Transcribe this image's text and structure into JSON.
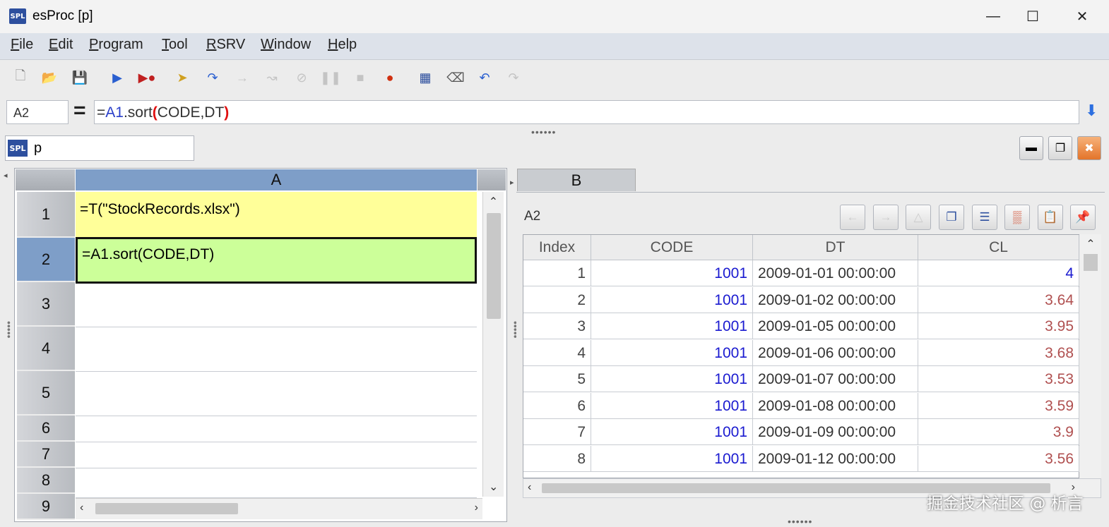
{
  "window": {
    "app_logo": "SPL",
    "title": "esProc  [p]"
  },
  "menu": [
    {
      "accel": "F",
      "rest": "ile"
    },
    {
      "accel": "E",
      "rest": "dit"
    },
    {
      "accel": "P",
      "rest": "rogram"
    },
    {
      "accel": "T",
      "rest": "ool"
    },
    {
      "accel": "R",
      "rest": "SRV"
    },
    {
      "accel": "W",
      "rest": "indow"
    },
    {
      "accel": "H",
      "rest": "elp"
    }
  ],
  "formula_bar": {
    "cell_ref": "A2",
    "eq": "=",
    "formula": {
      "p1": "=",
      "ref": "A1",
      "p2": ".sort",
      "open": "(",
      "args": "CODE,DT",
      "close": ")"
    }
  },
  "doc_tab": {
    "logo": "SPL",
    "name": "p"
  },
  "grid": {
    "column_header": "A",
    "rows": [
      "1",
      "2",
      "3",
      "4",
      "5",
      "6",
      "7",
      "8",
      "9"
    ],
    "cells": {
      "A1": "=T(\"StockRecords.xlsx\")",
      "A2": "=A1.sort(CODE,DT)"
    }
  },
  "result": {
    "tab": "B",
    "cell": "A2",
    "columns": [
      "Index",
      "CODE",
      "DT",
      "CL"
    ],
    "rows": [
      [
        "1",
        "1001",
        "2009-01-01 00:00:00",
        "4"
      ],
      [
        "2",
        "1001",
        "2009-01-02 00:00:00",
        "3.64"
      ],
      [
        "3",
        "1001",
        "2009-01-05 00:00:00",
        "3.95"
      ],
      [
        "4",
        "1001",
        "2009-01-06 00:00:00",
        "3.68"
      ],
      [
        "5",
        "1001",
        "2009-01-07 00:00:00",
        "3.53"
      ],
      [
        "6",
        "1001",
        "2009-01-08 00:00:00",
        "3.59"
      ],
      [
        "7",
        "1001",
        "2009-01-09 00:00:00",
        "3.9"
      ],
      [
        "8",
        "1001",
        "2009-01-12 00:00:00",
        "3.56"
      ]
    ]
  },
  "watermark": "掘金技术社区 @ 析言",
  "colors": {
    "selected_header": "#7e9ec8",
    "cell_a1_bg": "#ffff99",
    "cell_a2_bg": "#ccff99",
    "number_blue": "#1a1ad0",
    "value_red": "#b05050"
  }
}
